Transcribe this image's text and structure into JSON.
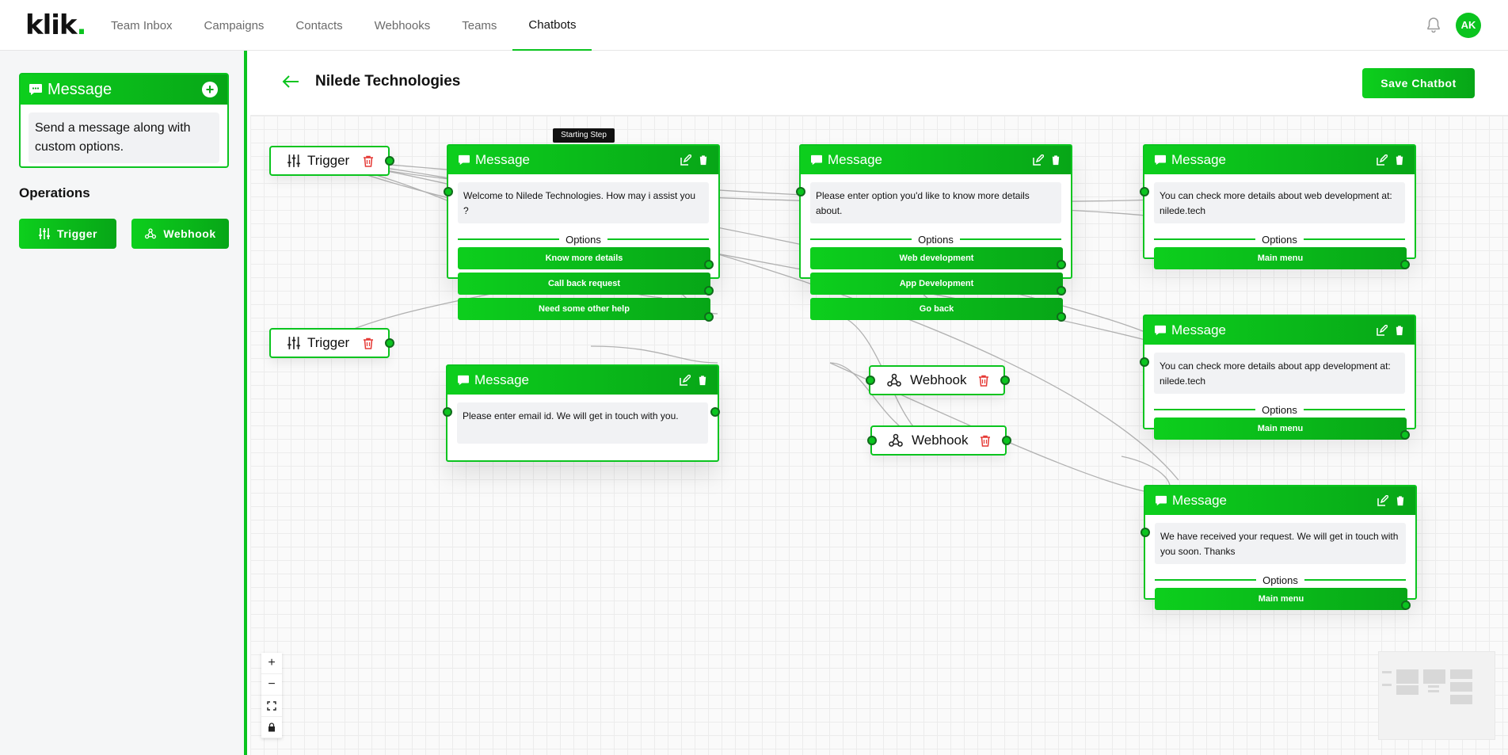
{
  "app": {
    "logo": "klik",
    "logo_dot": "."
  },
  "nav": {
    "items": [
      "Team Inbox",
      "Campaigns",
      "Contacts",
      "Webhooks",
      "Teams",
      "Chatbots"
    ],
    "active": "Chatbots"
  },
  "user": {
    "initials": "AK"
  },
  "sidebar": {
    "message_card": {
      "title": "Message",
      "description": "Send a message along with custom options."
    },
    "operations_title": "Operations",
    "operations": [
      {
        "label": "Trigger",
        "icon": "sliders-icon"
      },
      {
        "label": "Webhook",
        "icon": "webhook-icon"
      }
    ]
  },
  "header": {
    "title": "Nilede Technologies",
    "save_label": "Save Chatbot"
  },
  "canvas": {
    "starting_step_label": "Starting Step",
    "options_label": "Options",
    "triggers": [
      {
        "label": "Trigger"
      },
      {
        "label": "Trigger"
      }
    ],
    "webhooks": [
      {
        "label": "Webhook"
      },
      {
        "label": "Webhook"
      }
    ],
    "messages": [
      {
        "title": "Message",
        "text": "Welcome to Nilede Technologies. How may i assist you ?",
        "options": [
          "Know more details",
          "Call back request",
          "Need some other help"
        ]
      },
      {
        "title": "Message",
        "text": "Please enter email id. We will get in touch with you.",
        "options": []
      },
      {
        "title": "Message",
        "text": "Please enter option you'd like to know more details about.",
        "options": [
          "Web development",
          "App Development",
          "Go back"
        ]
      },
      {
        "title": "Message",
        "text": "You can check more details about web development at: nilede.tech",
        "options": [
          "Main menu"
        ]
      },
      {
        "title": "Message",
        "text": "You can check more details about app development at: nilede.tech",
        "options": [
          "Main menu"
        ]
      },
      {
        "title": "Message",
        "text": "We have received your request. We will get in touch with you soon. Thanks",
        "options": [
          "Main menu"
        ]
      }
    ]
  },
  "zoom_controls": [
    "+",
    "−",
    "fit",
    "lock"
  ],
  "colors": {
    "accent": "#0bc41f",
    "accent_dark": "#07a617",
    "delete": "#e53935"
  }
}
